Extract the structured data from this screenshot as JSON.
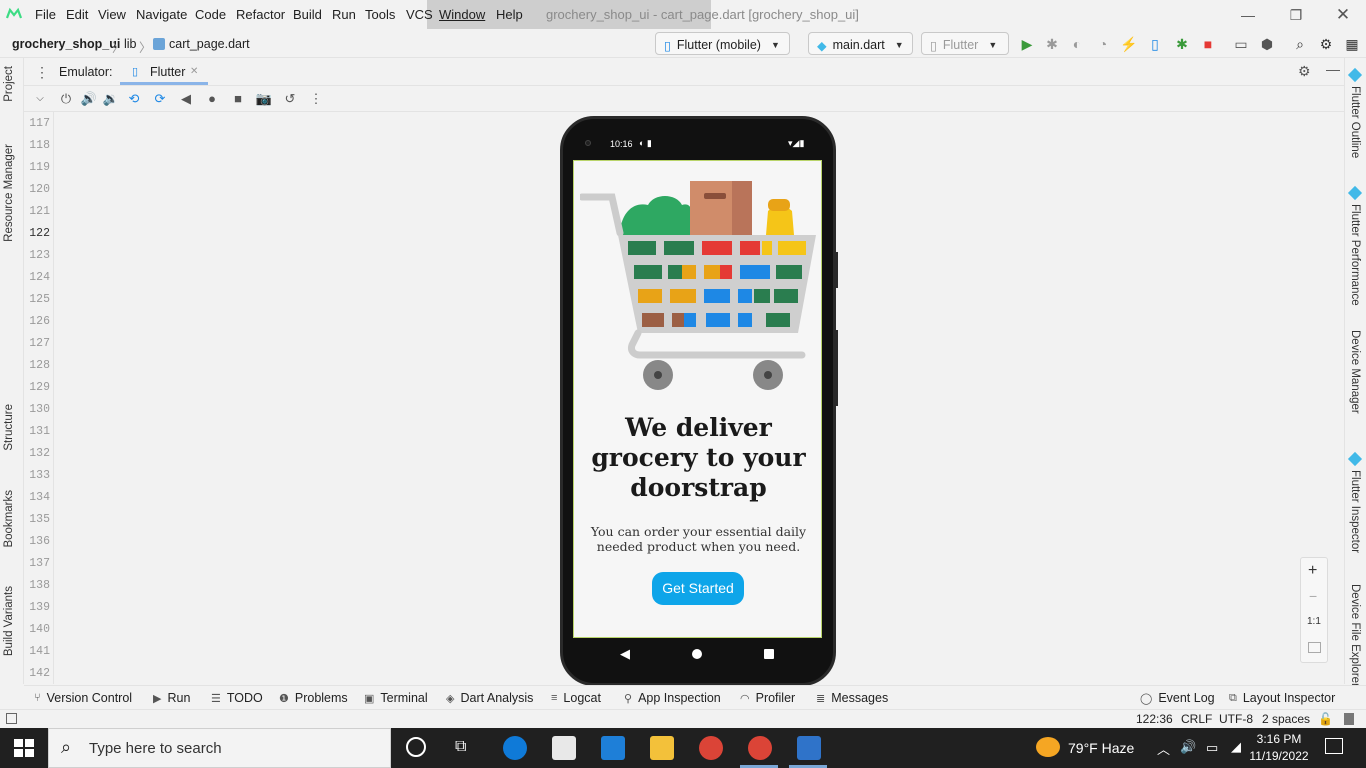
{
  "menubar": {
    "items": [
      "File",
      "Edit",
      "View",
      "Navigate",
      "Code",
      "Refactor",
      "Build",
      "Run",
      "Tools",
      "VCS",
      "Window",
      "Help"
    ],
    "window_title": "grochery_shop_ui - cart_page.dart [grochery_shop_ui]"
  },
  "navbar": {
    "project": "grochery_shop_ui",
    "folder": "lib",
    "file": "cart_page.dart",
    "device": "Flutter (mobile)",
    "run_config": "main.dart",
    "flutter_button": "Flutter"
  },
  "emulator": {
    "label": "Emulator:",
    "tab": "Flutter"
  },
  "left_tools": [
    "Project",
    "Resource Manager",
    "Structure",
    "Bookmarks",
    "Build Variants"
  ],
  "right_tools": [
    "Flutter Outline",
    "Flutter Performance",
    "Device Manager",
    "Flutter Inspector",
    "Device File Explorer"
  ],
  "gutter": {
    "lines": [
      "117",
      "118",
      "119",
      "120",
      "121",
      "122",
      "123",
      "124",
      "125",
      "126",
      "127",
      "128",
      "129",
      "130",
      "131",
      "132",
      "133",
      "134",
      "135",
      "136",
      "137",
      "138",
      "139",
      "140",
      "141",
      "142"
    ],
    "current_line": "122"
  },
  "phone": {
    "status_time": "10:16",
    "headline": "We deliver grocery to your doorstrap",
    "subtitle": "You can order your essential daily needed product when you need.",
    "cta": "Get Started"
  },
  "zoom": {
    "plus": "+",
    "minus": "−",
    "one_to_one": "1:1"
  },
  "bottom_tools": [
    "Version Control",
    "Run",
    "TODO",
    "Problems",
    "Terminal",
    "Dart Analysis",
    "Logcat",
    "App Inspection",
    "Profiler",
    "Messages",
    "Event Log",
    "Layout Inspector"
  ],
  "statusline": {
    "position": "122:36",
    "line_sep": "CRLF",
    "encoding": "UTF-8",
    "indent": "2 spaces"
  },
  "taskbar": {
    "search_placeholder": "Type here to search",
    "weather": "79°F  Haze",
    "time": "3:16 PM",
    "date": "11/19/2022"
  },
  "colors": {
    "accent_blue": "#0ea5e9",
    "run_green": "#3a9a3a",
    "stop_red": "#e53935"
  }
}
